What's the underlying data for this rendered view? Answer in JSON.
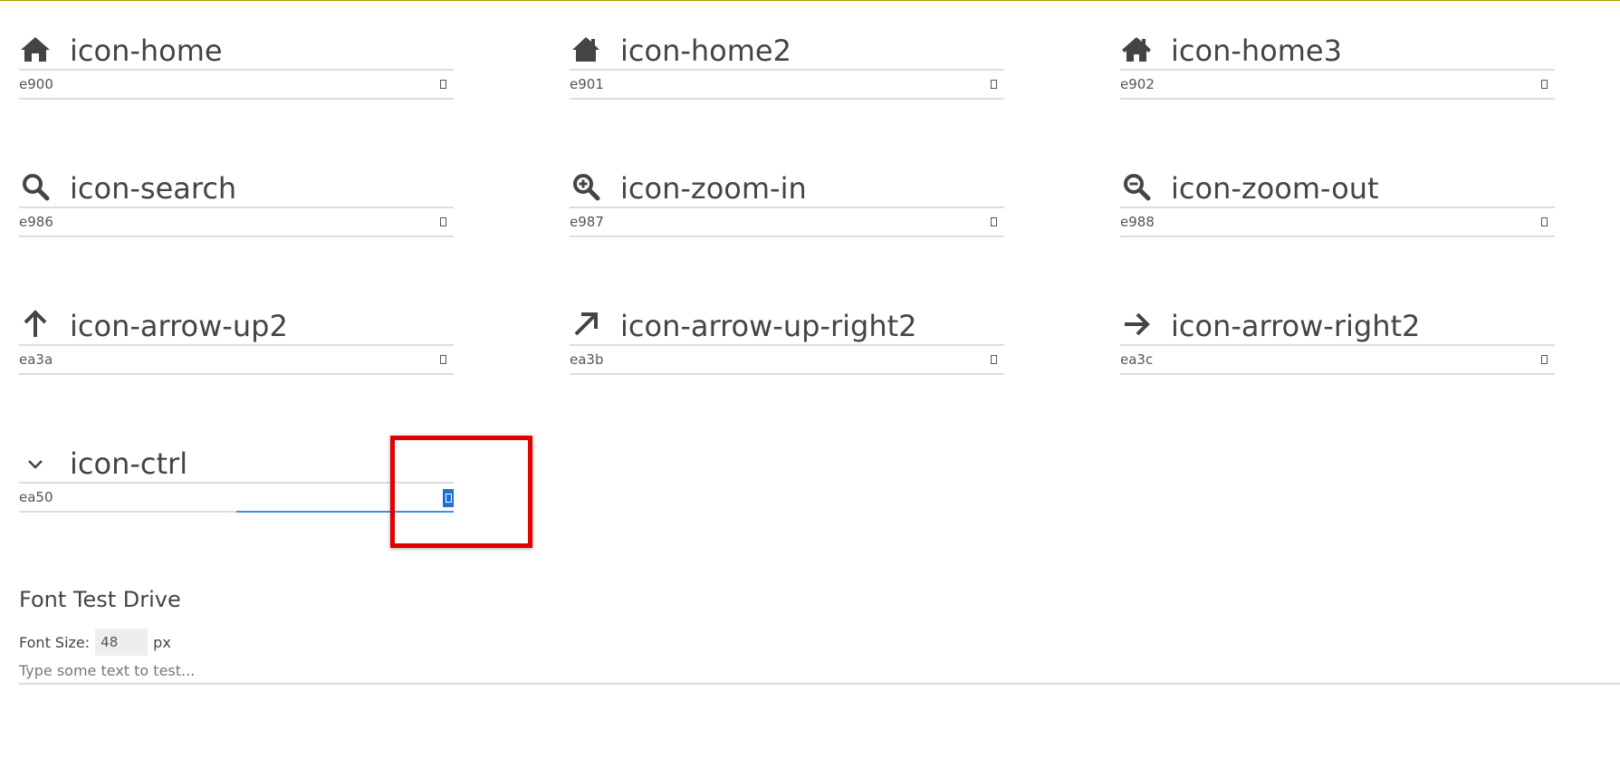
{
  "glyphs": [
    {
      "name": "icon-home",
      "code": "e900",
      "icon": "home-icon"
    },
    {
      "name": "icon-home2",
      "code": "e901",
      "icon": "home2-icon"
    },
    {
      "name": "icon-home3",
      "code": "e902",
      "icon": "home3-icon"
    },
    {
      "name": "icon-search",
      "code": "e986",
      "icon": "search-icon"
    },
    {
      "name": "icon-zoom-in",
      "code": "e987",
      "icon": "zoom-in-icon"
    },
    {
      "name": "icon-zoom-out",
      "code": "e988",
      "icon": "zoom-out-icon"
    },
    {
      "name": "icon-arrow-up2",
      "code": "ea3a",
      "icon": "arrow-up-icon"
    },
    {
      "name": "icon-arrow-up-right2",
      "code": "ea3b",
      "icon": "arrow-up-right-icon"
    },
    {
      "name": "icon-arrow-right2",
      "code": "ea3c",
      "icon": "arrow-right-icon"
    },
    {
      "name": "icon-ctrl",
      "code": "ea50",
      "icon": "ctrl-chevron-icon"
    }
  ],
  "test_drive": {
    "title": "Font Test Drive",
    "font_size_label": "Font Size:",
    "font_size_value": "48",
    "font_size_unit": "px",
    "text_placeholder": "Type some text to test..."
  },
  "colors": {
    "text": "#444444",
    "divider": "#dddddd",
    "focus": "#3d8fe0",
    "selection": "#1e6fd8",
    "highlight": "#e00000",
    "top_rule": "#a6a000"
  }
}
